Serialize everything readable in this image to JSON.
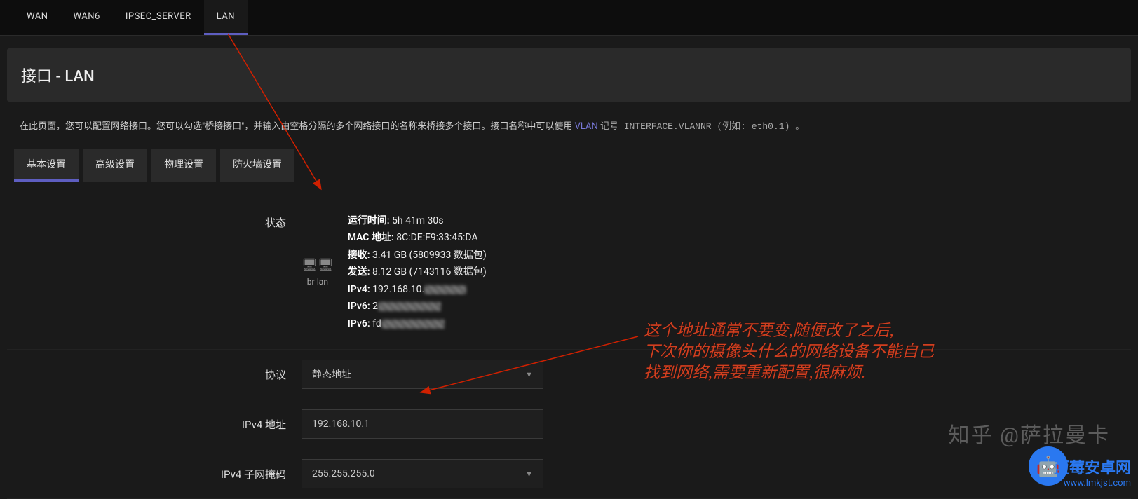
{
  "top_tabs": {
    "wan": "WAN",
    "wan6": "WAN6",
    "ipsec": "IPSEC_SERVER",
    "lan": "LAN"
  },
  "page_title": "接口 - LAN",
  "description": {
    "pre": "在此页面，您可以配置网络接口。您可以勾选\"桥接接口\"，并输入由空格分隔的多个网络接口的名称来桥接多个接口。接口名称中可以使用 ",
    "link": "VLAN",
    "post_code": " 记号 INTERFACE.VLANNR (例如: eth0.1) 。"
  },
  "sub_tabs": {
    "basic": "基本设置",
    "advanced": "高级设置",
    "physical": "物理设置",
    "firewall": "防火墙设置"
  },
  "status": {
    "label": "状态",
    "iface_name": "br-lan",
    "uptime_label": "运行时间:",
    "uptime_value": "5h 41m 30s",
    "mac_label": "MAC 地址:",
    "mac_value": "8C:DE:F9:33:45:DA",
    "rx_label": "接收:",
    "rx_value": "3.41 GB (5809933 数据包)",
    "tx_label": "发送:",
    "tx_value": "8.12 GB (7143116 数据包)",
    "ipv4_label": "IPv4:",
    "ipv4_value": "192.168.10.",
    "ipv6a_label": "IPv6:",
    "ipv6a_prefix": "2",
    "ipv6b_label": "IPv6:",
    "ipv6b_prefix": "fd"
  },
  "protocol": {
    "label": "协议",
    "value": "静态地址"
  },
  "ipv4_addr": {
    "label": "IPv4 地址",
    "value": "192.168.10.1"
  },
  "netmask": {
    "label": "IPv4 子网掩码",
    "value": "255.255.255.0"
  },
  "annotation": {
    "line1": "这个地址通常不要变,随便改了之后,",
    "line2": "下次你的摄像头什么的网络设备不能自己",
    "line3": "找到网络,需要重新配置,很麻烦."
  },
  "watermark": {
    "zhihu": "知乎 @萨拉曼卡",
    "lm_cn": "蓝莓安卓网",
    "lm_url": "www.lmkjst.com"
  }
}
